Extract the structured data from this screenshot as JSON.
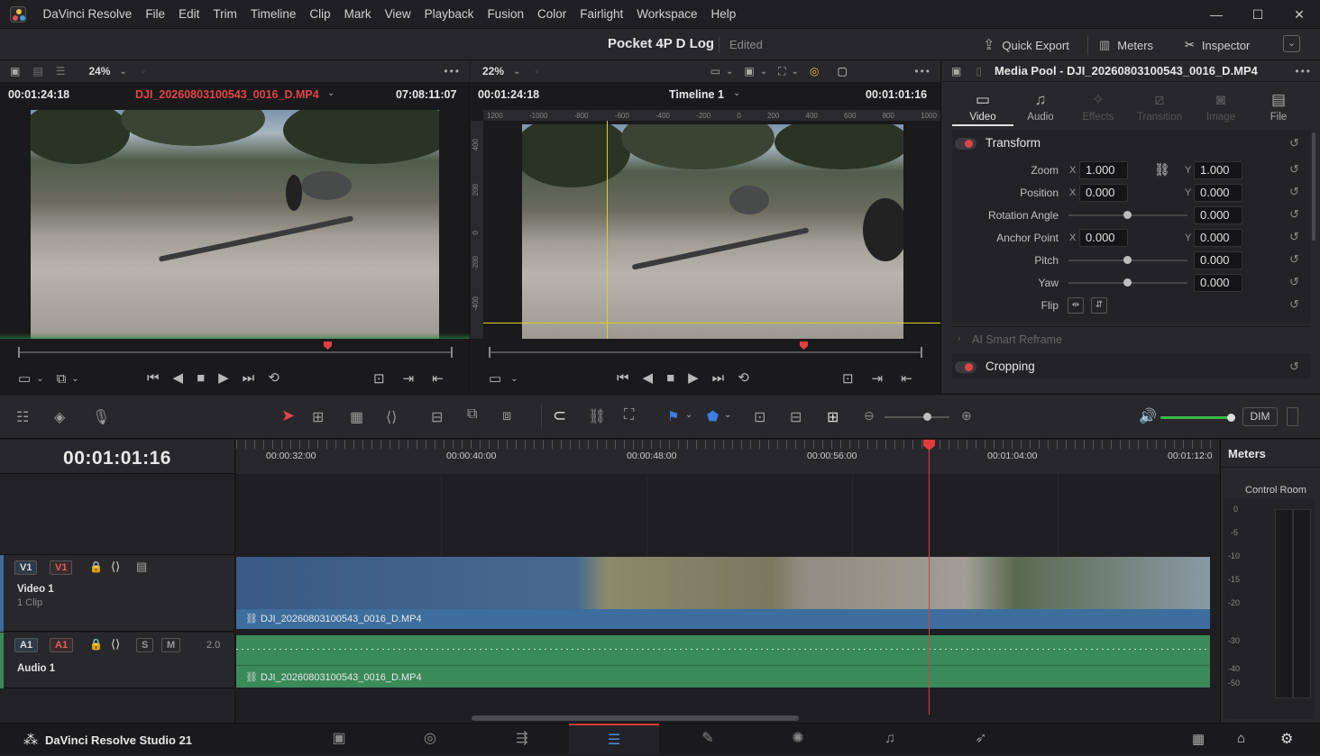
{
  "app": {
    "title": "DaVinci Resolve",
    "studio_label": "DaVinci Resolve Studio 21"
  },
  "menu": [
    "File",
    "Edit",
    "Trim",
    "Timeline",
    "Clip",
    "Mark",
    "View",
    "Playback",
    "Fusion",
    "Color",
    "Fairlight",
    "Workspace",
    "Help"
  ],
  "project": {
    "name": "Pocket 4P D Log",
    "status": "Edited"
  },
  "top_buttons": {
    "quick_export": "Quick Export",
    "meters": "Meters",
    "inspector": "Inspector"
  },
  "source_viewer": {
    "zoom": "24%",
    "timecode": "00:01:24:18",
    "clip_name": "DJI_20260803100543_0016_D.MP4",
    "duration": "07:08:11:07"
  },
  "timeline_viewer": {
    "zoom": "22%",
    "timecode": "00:01:24:18",
    "timeline_name": "Timeline 1",
    "current": "00:01:01:16",
    "ruler_ticks": [
      "1200",
      "-1000",
      "-800",
      "-600",
      "-400",
      "-200",
      "0",
      "200",
      "400",
      "600",
      "800",
      "1000"
    ],
    "v_ruler": [
      "400",
      "200",
      "0",
      "-200",
      "-400"
    ]
  },
  "inspector": {
    "title": "Media Pool - DJI_20260803100543_0016_D.MP4",
    "tabs": [
      "Video",
      "Audio",
      "Effects",
      "Transition",
      "Image",
      "File"
    ],
    "active_tab": "Video",
    "transform_label": "Transform",
    "zoom": {
      "label": "Zoom",
      "x": "1.000",
      "y": "1.000"
    },
    "position": {
      "label": "Position",
      "x": "0.000",
      "y": "0.000"
    },
    "rotation": {
      "label": "Rotation Angle",
      "value": "0.000"
    },
    "anchor": {
      "label": "Anchor Point",
      "x": "0.000",
      "y": "0.000"
    },
    "pitch": {
      "label": "Pitch",
      "value": "0.000"
    },
    "yaw": {
      "label": "Yaw",
      "value": "0.000"
    },
    "flip_label": "Flip",
    "ai_reframe": "AI Smart Reframe",
    "cropping": "Cropping",
    "x_label": "X",
    "y_label": "Y"
  },
  "toolbar": {
    "dim": "DIM"
  },
  "timeline": {
    "timecode": "00:01:01:16",
    "ruler": [
      "00:00:32:00",
      "00:00:40:00",
      "00:00:48:00",
      "00:00:56:00",
      "00:01:04:00",
      "00:01:12:0"
    ],
    "video_track": {
      "tag_a": "V1",
      "tag_b": "V1",
      "name": "Video 1",
      "clips": "1 Clip",
      "clip_name": "DJI_20260803100543_0016_D.MP4"
    },
    "audio_track": {
      "tag_a": "A1",
      "tag_b": "A1",
      "name": "Audio 1",
      "solo": "S",
      "mute": "M",
      "level": "2.0",
      "clip_name": "DJI_20260803100543_0016_D.MP4"
    }
  },
  "meters": {
    "title": "Meters",
    "subtitle": "Control Room",
    "scale": [
      "0",
      "-5",
      "-10",
      "-15",
      "-20",
      "-30",
      "-40",
      "-50"
    ]
  },
  "colors": {
    "accent_red": "#e04040",
    "video_clip": "#3d6e9e",
    "audio_clip": "#3a8a5a",
    "playhead": "#e03c3c"
  }
}
